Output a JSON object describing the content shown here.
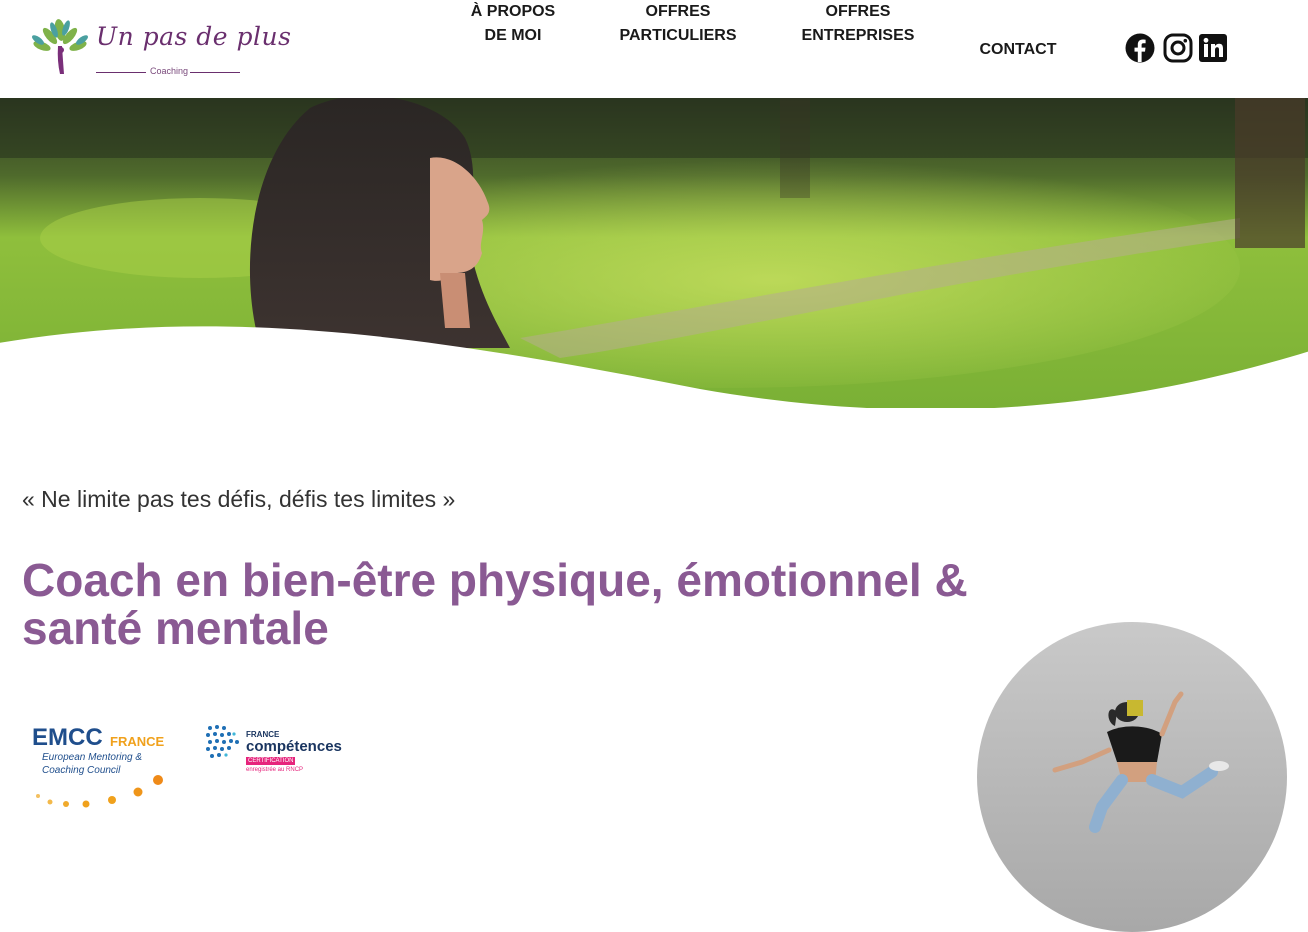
{
  "brand": {
    "name": "Un pas de plus",
    "tagline": "Coaching",
    "colors": {
      "purple": "#6a2f6e",
      "accent": "#8a5a93",
      "leaf": "#7fb24a"
    }
  },
  "nav": {
    "items": [
      {
        "line1": "À PROPOS",
        "line2": "DE MOI"
      },
      {
        "line1": "OFFRES",
        "line2": "PARTICULIERS"
      },
      {
        "line1": "OFFRES",
        "line2": "ENTREPRISES"
      },
      {
        "line1": "CONTACT",
        "line2": ""
      }
    ],
    "social": [
      "facebook-icon",
      "instagram-icon",
      "linkedin-icon"
    ]
  },
  "hero": {
    "quote": "« Ne limite pas tes défis, défis tes limites »",
    "headline": "Coach en bien-être physique, émotionnel & santé mentale"
  },
  "certifications": {
    "emcc": {
      "title": "EMCC",
      "country": "FRANCE",
      "line1": "European Mentoring &",
      "line2": "Coaching Council"
    },
    "france_competences": {
      "top": "FRANCE",
      "name": "compétences",
      "badge": "CERTIFICATION",
      "note": "enregistrée au RNCP"
    }
  }
}
